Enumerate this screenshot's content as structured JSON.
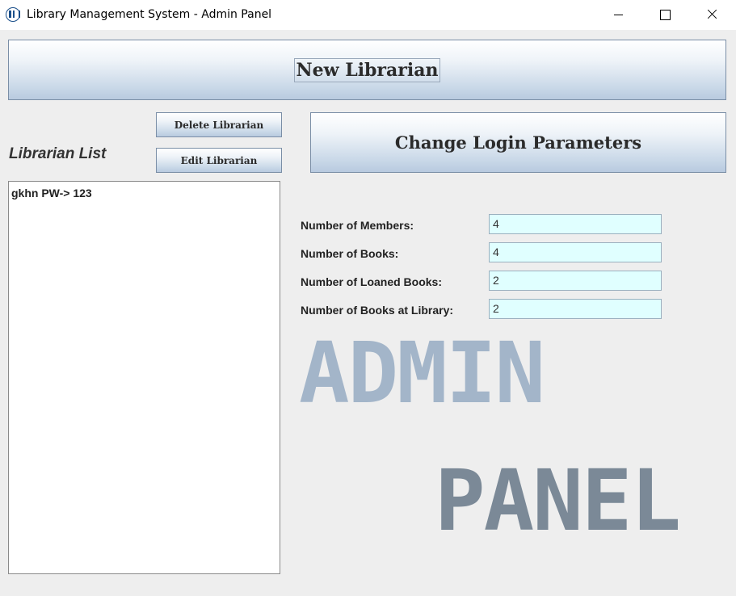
{
  "window": {
    "title": "Library Management System - Admin Panel",
    "icon": "library-app-icon",
    "controls": [
      "minimize-icon",
      "maximize-icon",
      "close-icon"
    ]
  },
  "buttons": {
    "new_librarian": "New Librarian",
    "delete_librarian": "Delete Librarian",
    "edit_librarian": "Edit Librarian",
    "change_login": "Change Login Parameters"
  },
  "librarian_list": {
    "title": "Librarian List",
    "items": [
      "gkhn PW-> 123"
    ]
  },
  "stats": [
    {
      "label": "Number of Members:",
      "value": "4"
    },
    {
      "label": "Number of Books:",
      "value": "4"
    },
    {
      "label": "Number of Loaned Books:",
      "value": "2"
    },
    {
      "label": "Number of Books at Library:",
      "value": "2"
    }
  ],
  "watermark": {
    "line1": "ADMIN",
    "line2": "PANEL"
  },
  "colors": {
    "field_bg": "#e0ffff",
    "watermark_light": "#a3b5c9",
    "watermark_dark": "#7b8997"
  }
}
